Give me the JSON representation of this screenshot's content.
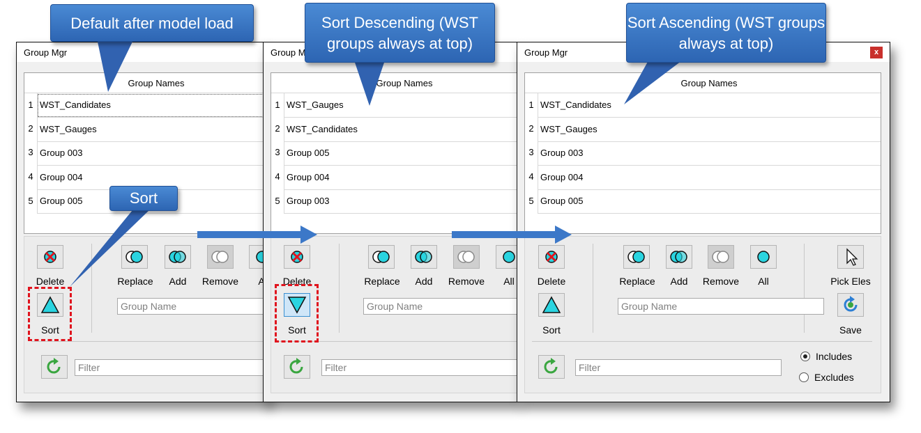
{
  "window_title": "Group Mgr",
  "close_glyph": "x",
  "column_header": "Group Names",
  "row_numbers": [
    "1",
    "2",
    "3",
    "4",
    "5"
  ],
  "panels": [
    {
      "title": "Group Mgr",
      "rows": [
        "WST_Candidates",
        "WST_Gauges",
        "Group 003",
        "Group 004",
        "Group 005"
      ]
    },
    {
      "title": "Group M",
      "rows": [
        "WST_Gauges",
        "WST_Candidates",
        "Group 005",
        "Group 004",
        "Group 003"
      ]
    },
    {
      "title": "Group Mgr",
      "rows": [
        "WST_Candidates",
        "WST_Gauges",
        "Group 003",
        "Group 004",
        "Group 005"
      ]
    }
  ],
  "buttons": {
    "delete": "Delete",
    "replace": "Replace",
    "add": "Add",
    "remove": "Remove",
    "all": "All",
    "all_clipped": "A",
    "pick_eles": "Pick Eles",
    "sort": "Sort",
    "save": "Save"
  },
  "inputs": {
    "group_name_placeholder": "Group Name",
    "filter_placeholder": "Filter"
  },
  "radio": {
    "includes": "Includes",
    "excludes": "Excludes",
    "selected": "includes"
  },
  "callouts": {
    "default": "Default after model load",
    "sort": "Sort",
    "descending": "Sort Descending (WST groups always at top)",
    "ascending": "Sort Ascending (WST groups always at top)"
  },
  "colors": {
    "callout_blue": "#3c78c8",
    "highlight_red": "#e0141e",
    "icon_cyan": "#2ad4e0",
    "refresh_green": "#3aa640"
  },
  "icons": {
    "delete": "delete-icon",
    "replace": "replace-icon",
    "add": "add-icon",
    "remove": "remove-icon",
    "all": "all-icon",
    "pick": "cursor-icon",
    "sort_up": "sort-ascending-icon",
    "sort_down": "sort-descending-icon",
    "save": "save-icon",
    "refresh": "refresh-icon"
  }
}
